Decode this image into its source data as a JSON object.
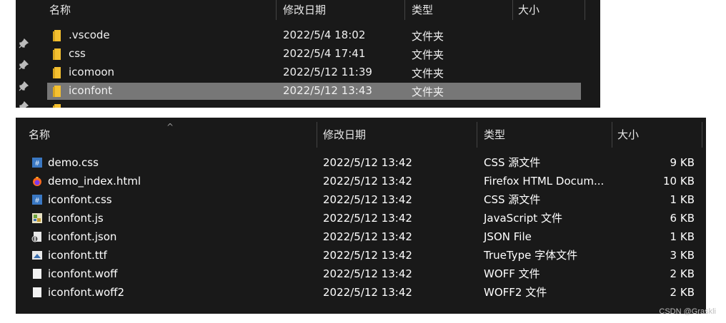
{
  "top_panel": {
    "columns": {
      "name": "名称",
      "date": "修改日期",
      "type": "类型",
      "size": "大小"
    },
    "rows": [
      {
        "name": ".vscode",
        "date": "2022/5/4 18:02",
        "type": "文件夹",
        "icon": "folder-icon",
        "selected": false
      },
      {
        "name": "css",
        "date": "2022/5/4 17:41",
        "type": "文件夹",
        "icon": "folder-icon",
        "selected": false
      },
      {
        "name": "icomoon",
        "date": "2022/5/12 11:39",
        "type": "文件夹",
        "icon": "folder-icon",
        "selected": false
      },
      {
        "name": "iconfont",
        "date": "2022/5/12 13:43",
        "type": "文件夹",
        "icon": "folder-icon",
        "selected": true
      }
    ],
    "pins": [
      "pin-icon",
      "pin-icon",
      "pin-icon"
    ]
  },
  "bottom_panel": {
    "columns": {
      "name": "名称",
      "date": "修改日期",
      "type": "类型",
      "size": "大小"
    },
    "rows": [
      {
        "name": "demo.css",
        "date": "2022/5/12 13:42",
        "type": "CSS 源文件",
        "size": "9 KB",
        "icon": "css-file-icon"
      },
      {
        "name": "demo_index.html",
        "date": "2022/5/12 13:42",
        "type": "Firefox HTML Docum...",
        "size": "10 KB",
        "icon": "firefox-html-icon"
      },
      {
        "name": "iconfont.css",
        "date": "2022/5/12 13:42",
        "type": "CSS 源文件",
        "size": "1 KB",
        "icon": "css-file-icon"
      },
      {
        "name": "iconfont.js",
        "date": "2022/5/12 13:42",
        "type": "JavaScript 文件",
        "size": "6 KB",
        "icon": "js-file-icon"
      },
      {
        "name": "iconfont.json",
        "date": "2022/5/12 13:42",
        "type": "JSON File",
        "size": "1 KB",
        "icon": "json-file-icon"
      },
      {
        "name": "iconfont.ttf",
        "date": "2022/5/12 13:42",
        "type": "TrueType 字体文件",
        "size": "3 KB",
        "icon": "font-file-icon"
      },
      {
        "name": "iconfont.woff",
        "date": "2022/5/12 13:42",
        "type": "WOFF 文件",
        "size": "2 KB",
        "icon": "generic-file-icon"
      },
      {
        "name": "iconfont.woff2",
        "date": "2022/5/12 13:42",
        "type": "WOFF2 文件",
        "size": "2 KB",
        "icon": "generic-file-icon"
      }
    ]
  },
  "watermark": "CSDN @Graskli",
  "colors": {
    "panel_bg": "#191919",
    "selected_bg": "#777777",
    "folder": "#f4c030"
  }
}
